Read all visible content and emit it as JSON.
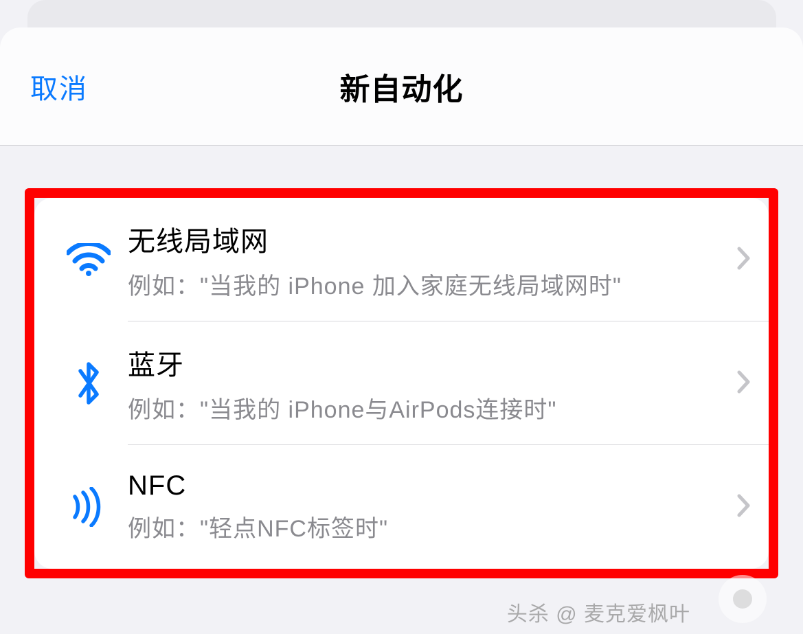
{
  "header": {
    "cancel": "取消",
    "title": "新自动化"
  },
  "list": {
    "wifi": {
      "title": "无线局域网",
      "sub": "例如：\"当我的 iPhone 加入家庭无线局域网时\""
    },
    "bluetooth": {
      "title": "蓝牙",
      "sub": "例如：\"当我的 iPhone与AirPods连接时\""
    },
    "nfc": {
      "title": "NFC",
      "sub": "例如：\"轻点NFC标签时\""
    }
  },
  "watermark": "头杀 @ 麦克爱枫叶"
}
